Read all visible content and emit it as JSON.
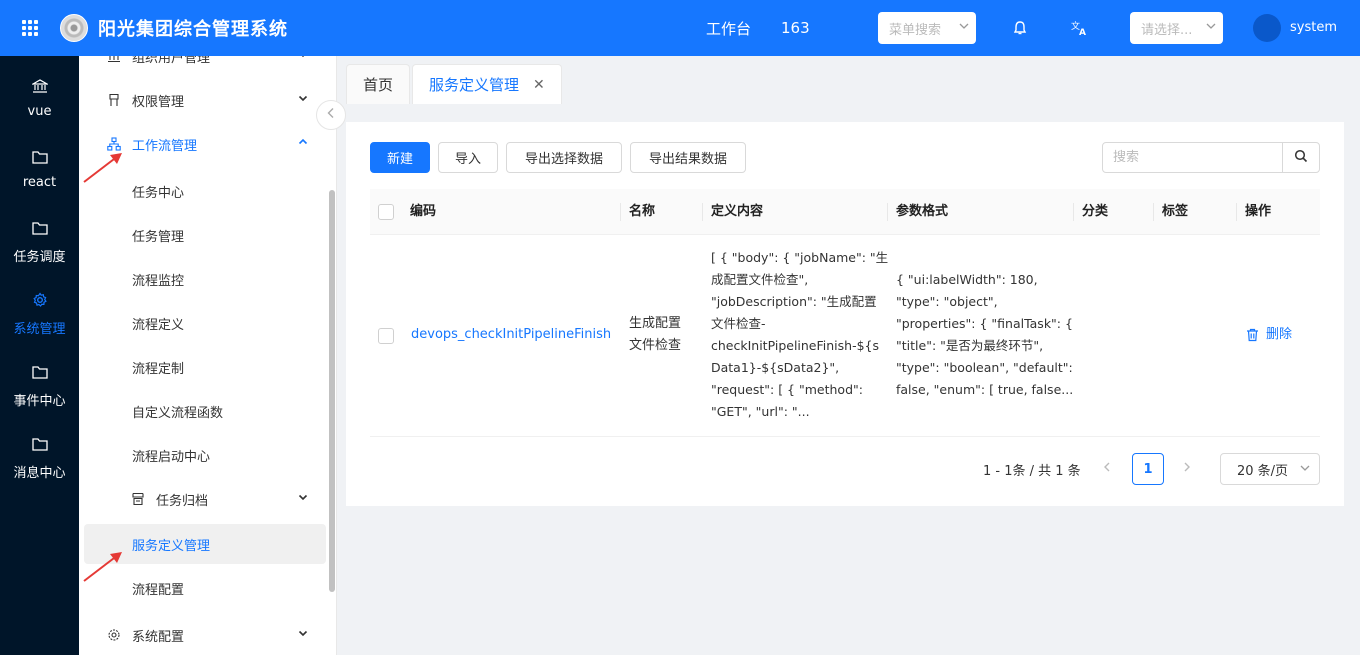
{
  "header": {
    "title": "阳光集团综合管理系统",
    "workbench": "工作台",
    "count": "163",
    "menu_search_placeholder": "菜单搜索",
    "select_placeholder": "请选择...",
    "username": "system",
    "brand_color": "#1677ff"
  },
  "rail": {
    "items": [
      {
        "label": "vue",
        "icon": "bank-icon"
      },
      {
        "label": "react",
        "icon": "folder-icon"
      },
      {
        "label": "任务调度",
        "icon": "folder-icon"
      },
      {
        "label": "系统管理",
        "icon": "gear-icon",
        "active": true
      },
      {
        "label": "事件中心",
        "icon": "folder-icon"
      },
      {
        "label": "消息中心",
        "icon": "folder-icon"
      }
    ]
  },
  "sidebar": {
    "items": [
      {
        "label": "组织用户管理"
      },
      {
        "label": "权限管理"
      },
      {
        "label": "工作流管理"
      },
      {
        "label": "任务中心"
      },
      {
        "label": "任务管理"
      },
      {
        "label": "流程监控"
      },
      {
        "label": "流程定义"
      },
      {
        "label": "流程定制"
      },
      {
        "label": "自定义流程函数"
      },
      {
        "label": "流程启动中心"
      },
      {
        "label": "任务归档"
      },
      {
        "label": "服务定义管理"
      },
      {
        "label": "流程配置"
      },
      {
        "label": "系统配置"
      }
    ]
  },
  "tabs": [
    {
      "label": "首页"
    },
    {
      "label": "服务定义管理",
      "close": "✕"
    }
  ],
  "toolbar": {
    "new": "新建",
    "import": "导入",
    "export_selected": "导出选择数据",
    "export_result": "导出结果数据",
    "search_placeholder": "搜索"
  },
  "table": {
    "columns": [
      "编码",
      "名称",
      "定义内容",
      "参数格式",
      "分类",
      "标签",
      "操作"
    ],
    "rows": [
      {
        "code": "devops_checkInitPipelineFinish",
        "name_lines": [
          "生成配置",
          "文件检查"
        ],
        "definition_lines": [
          "[ { \"body\": { \"jobName\": \"生",
          "成配置文件检查\",",
          "\"jobDescription\": \"生成配置",
          "文件检查-",
          "checkInitPipelineFinish-${s",
          "Data1}-${sData2}\",",
          "\"request\": [ { \"method\":",
          "\"GET\", \"url\": \"..."
        ],
        "params_lines": [
          "{ \"ui:labelWidth\": 180,",
          "\"type\": \"object\",",
          "\"properties\": { \"finalTask\": {",
          "\"title\": \"是否为最终环节\",",
          "\"type\": \"boolean\", \"default\":",
          "false, \"enum\": [ true, false..."
        ],
        "action": "删除"
      }
    ]
  },
  "pagination": {
    "summary": "1 - 1条 / 共 1 条",
    "current": "1",
    "page_size": "20 条/页"
  }
}
